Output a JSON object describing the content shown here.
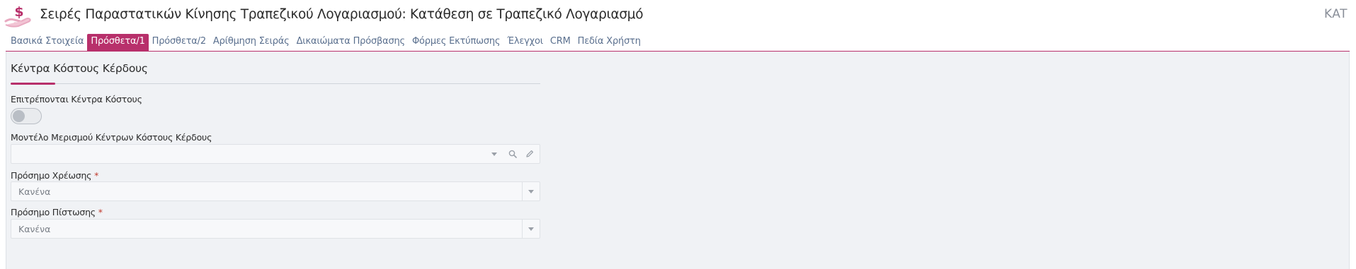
{
  "header": {
    "title": "Σειρές Παραστατικών Κίνησης Τραπεζικού Λογαριασμού: Κατάθεση σε Τραπεζικό Λογαριασμό",
    "code": "KAT",
    "logo_icon": "money-hand-icon"
  },
  "tabs": [
    {
      "label": "Βασικά Στοιχεία",
      "active": false
    },
    {
      "label": "Πρόσθετα/1",
      "active": true
    },
    {
      "label": "Πρόσθετα/2",
      "active": false
    },
    {
      "label": "Αρίθμηση Σειράς",
      "active": false
    },
    {
      "label": "Δικαιώματα Πρόσβασης",
      "active": false
    },
    {
      "label": "Φόρμες Εκτύπωσης",
      "active": false
    },
    {
      "label": "Έλεγχοι",
      "active": false
    },
    {
      "label": "CRM",
      "active": false
    },
    {
      "label": "Πεδία Χρήστη",
      "active": false
    }
  ],
  "section": {
    "title": "Κέντρα Κόστους Κέρδους"
  },
  "fields": {
    "allow_cost_centers": {
      "label": "Επιτρέπονται Κέντρα Κόστους",
      "checked": false
    },
    "allocation_model": {
      "label": "Μοντέλο Μερισμού Κέντρων Κόστους Κέρδους",
      "value": ""
    },
    "debit_sign": {
      "label": "Πρόσημο Χρέωσης",
      "required_mark": "*",
      "value": "Κανένα"
    },
    "credit_sign": {
      "label": "Πρόσημο Πίστωσης",
      "required_mark": "*",
      "value": "Κανένα"
    }
  },
  "colors": {
    "accent": "#b8306b",
    "tab_text": "#5a6f8e",
    "panel_bg": "#f0f2f5"
  }
}
